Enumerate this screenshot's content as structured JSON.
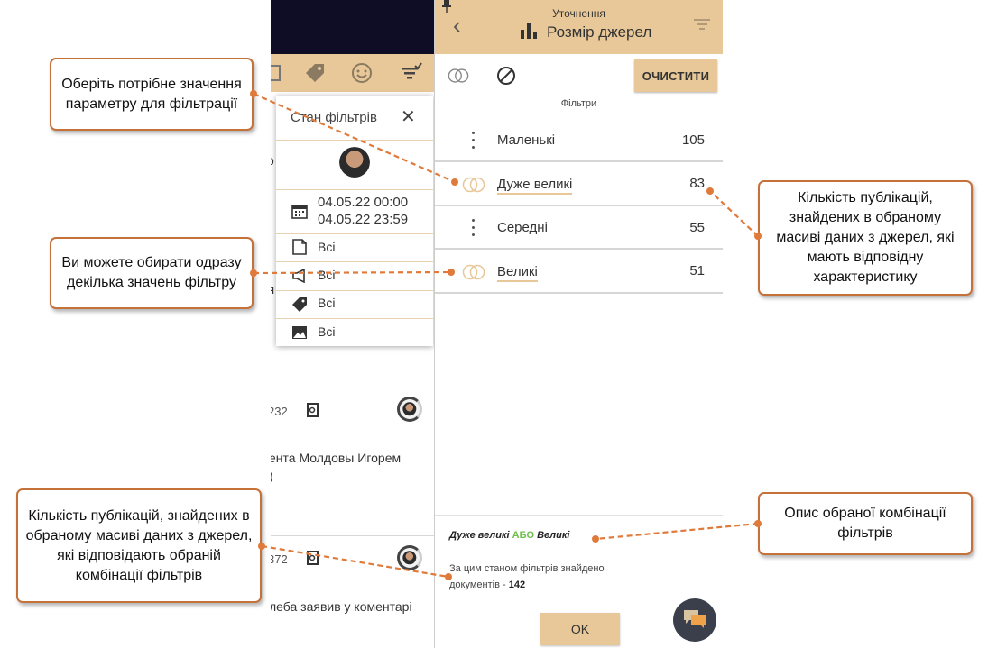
{
  "background_app": {
    "text_rows": [
      "ента Молдовы Игорем",
      ")",
      "леба заявив у коментарі"
    ],
    "counts": [
      "232",
      "372"
    ],
    "fragments": [
      "о",
      "я"
    ]
  },
  "filter_state": {
    "title": "Стан фільтрів",
    "date_from": "04.05.22 00:00",
    "date_to": "04.05.22 23:59",
    "rows": [
      {
        "icon": "document-icon",
        "value": "Всі"
      },
      {
        "icon": "megaphone-icon",
        "value": "Всі"
      },
      {
        "icon": "tag-icon",
        "value": "Всі"
      },
      {
        "icon": "image-icon",
        "value": "Всі"
      }
    ]
  },
  "panel": {
    "subtitle": "Уточнення",
    "title": "Розмір джерел",
    "clear_label": "ОЧИСТИТИ",
    "filters_caption": "Фільтри",
    "filters": [
      {
        "label": "Маленькі",
        "count": "105",
        "selected": false
      },
      {
        "label": "Дуже великі",
        "count": "83",
        "selected": true
      },
      {
        "label": "Середні",
        "count": "55",
        "selected": false
      },
      {
        "label": "Великі",
        "count": "51",
        "selected": true
      }
    ],
    "combination": {
      "left": "Дуже великі",
      "operator": "АБО",
      "right": "Великі"
    },
    "found_text": "За цим станом фільтрів знайдено документів - ",
    "found_count": "142",
    "ok_label": "OK"
  },
  "callouts": {
    "choose_value": "Оберіть потрібне значення параметру для фільтрації",
    "multi_select": "Ви можете обирати одразу декілька значень фільтру",
    "count_per_value": "Кількість публікацій, знайдених в обраному масиві даних з джерел, які мають відповідну характеристику",
    "count_combination": "Кількість публікацій, знайдених в обраному масиві даних з джерел, які відповідають обраній комбінації фільтрів",
    "combination_description": "Опис обраної комбінації фільтрів"
  },
  "colors": {
    "accent": "#e8c898",
    "callout_border": "#c4713a",
    "operator": "#6bbf4a",
    "topbar": "#0f0d26"
  }
}
